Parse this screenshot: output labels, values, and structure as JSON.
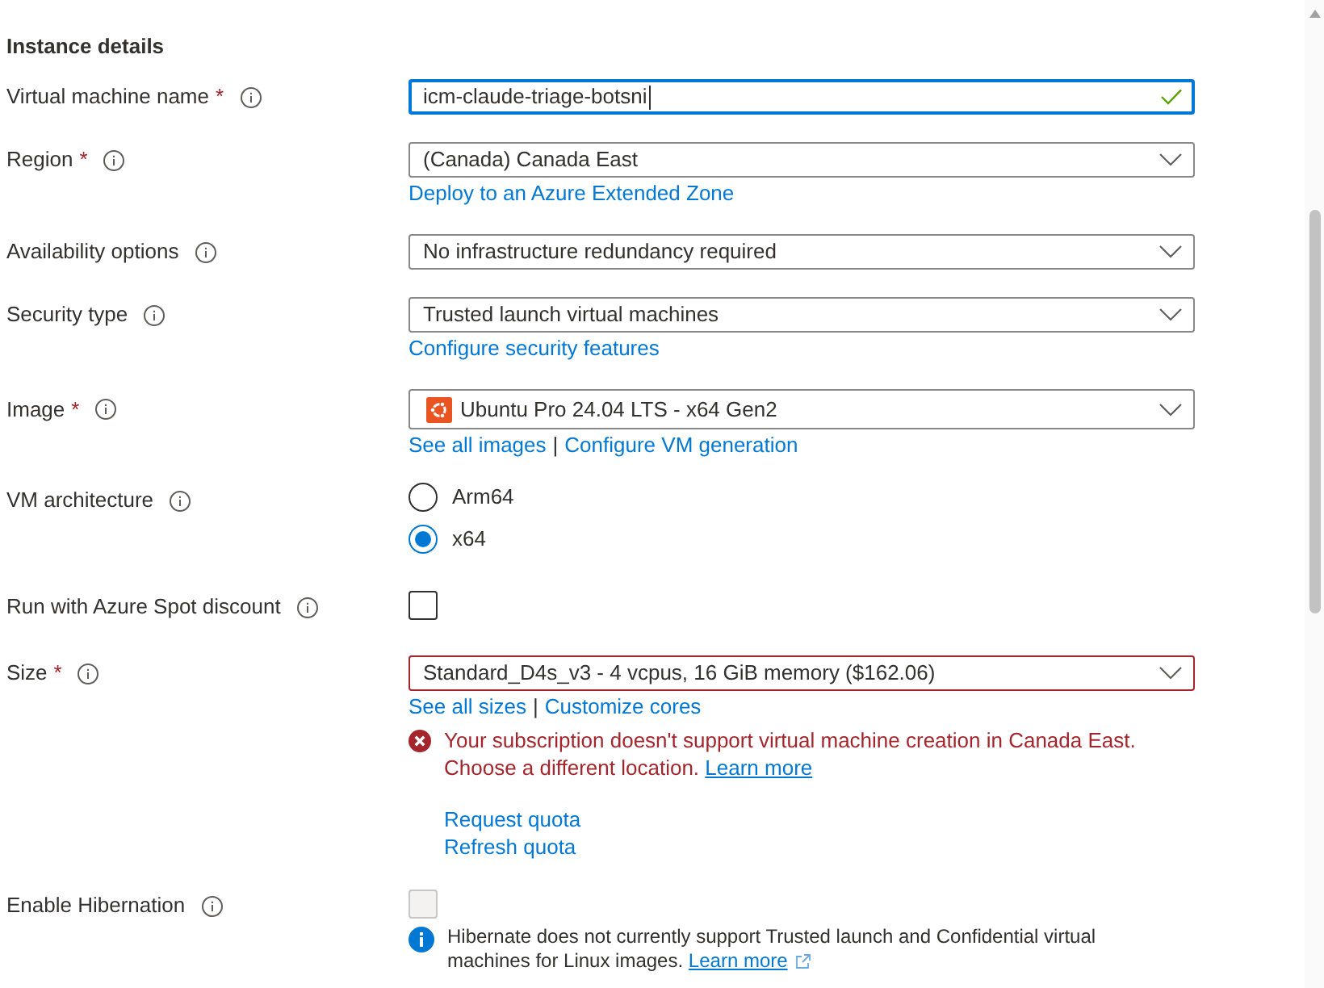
{
  "section_title": "Instance details",
  "fields": [
    {
      "kind": "text_input",
      "label": "Virtual machine name",
      "required_mark": "*",
      "value": "icm-claude-triage-botsni",
      "focused": true,
      "valid": true
    },
    {
      "kind": "dropdown",
      "label": "Region",
      "required_mark": "*",
      "value": "(Canada) Canada East",
      "invalid": false,
      "links": [
        "Deploy to an Azure Extended Zone"
      ]
    },
    {
      "kind": "dropdown",
      "label": "Availability options",
      "value": "No infrastructure redundancy required",
      "invalid": false
    },
    {
      "kind": "dropdown",
      "label": "Security type",
      "value": "Trusted launch virtual machines",
      "invalid": false,
      "links": [
        "Configure security features"
      ]
    },
    {
      "kind": "image_dropdown",
      "label": "Image",
      "required_mark": "*",
      "value": "Ubuntu Pro 24.04 LTS - x64 Gen2",
      "invalid": false,
      "links": [
        "See all images",
        "Configure VM generation"
      ],
      "link_separator": "|"
    },
    {
      "kind": "radio_group",
      "label": "VM architecture",
      "options": [
        {
          "label": "Arm64",
          "selected": false
        },
        {
          "label": "x64",
          "selected": true
        }
      ]
    },
    {
      "kind": "checkbox",
      "label": "Run with Azure Spot discount",
      "checked": false,
      "disabled": false
    },
    {
      "kind": "dropdown",
      "label": "Size",
      "required_mark": "*",
      "value": "Standard_D4s_v3 - 4 vcpus, 16 GiB memory ($162.06)",
      "invalid": true,
      "links": [
        "See all sizes",
        "Customize cores"
      ],
      "link_separator": "|",
      "error": {
        "text": "Your subscription doesn't support virtual machine creation in Canada East. Choose a different location.",
        "link": "Learn more"
      },
      "quota_links": [
        "Request quota",
        "Refresh quota"
      ]
    },
    {
      "kind": "checkbox",
      "label": "Enable Hibernation",
      "checked": false,
      "disabled": true,
      "note": {
        "text": "Hibernate does not currently support Trusted launch and Confidential virtual machines for Linux images.",
        "link": "Learn more"
      }
    }
  ]
}
